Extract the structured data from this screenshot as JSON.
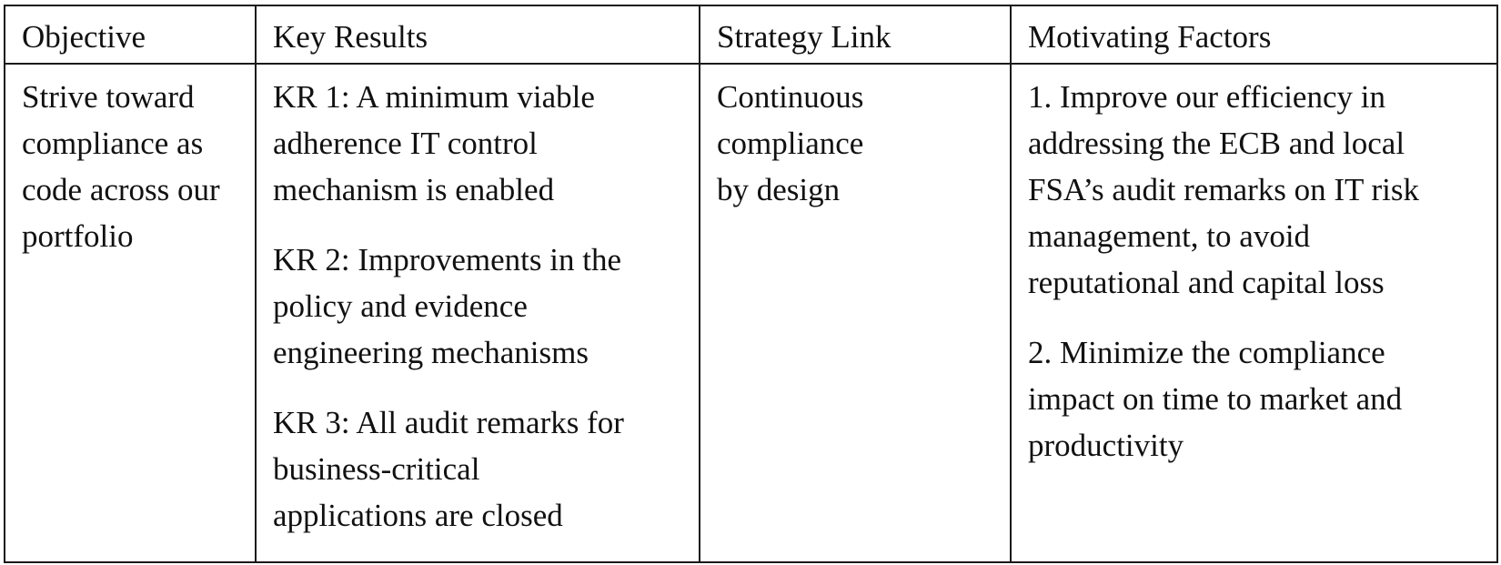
{
  "table": {
    "headers": [
      "Objective",
      "Key Results",
      "Strategy Link",
      "Motivating Factors"
    ],
    "rows": [
      {
        "objective": "Strive toward compliance as code across our portfolio",
        "key_results": [
          "KR 1: A minimum viable adherence IT control mechanism is enabled",
          "KR 2: Improvements in the policy and evidence engineering mechanisms",
          "KR 3: All audit remarks for business-critical applications are closed"
        ],
        "strategy_link": "Continuous compliance by design",
        "motivating_factors": [
          "1. Improve our efficiency in addressing the ECB and local FSA’s audit remarks on IT risk management, to avoid reputational and capital loss",
          "2. Minimize the compliance impact on time to market and productivity"
        ]
      }
    ]
  }
}
